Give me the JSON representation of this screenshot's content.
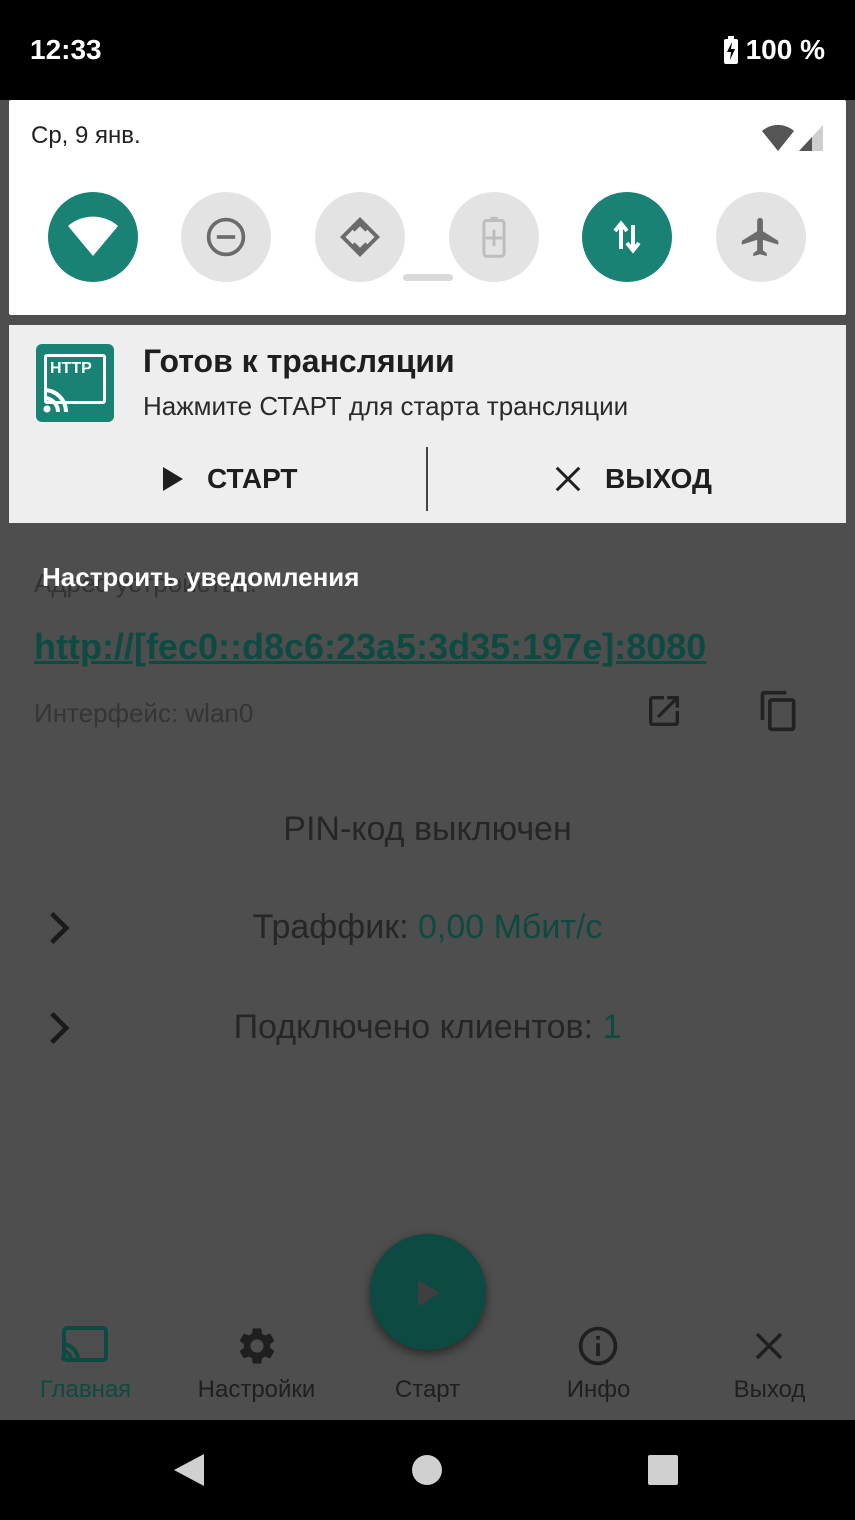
{
  "status_bar": {
    "time": "12:33",
    "battery": "100 %"
  },
  "quick_settings": {
    "date": "Ср, 9 янв.",
    "tiles": [
      {
        "name": "wifi",
        "state": "on"
      },
      {
        "name": "do-not-disturb",
        "state": "off"
      },
      {
        "name": "auto-rotate",
        "state": "off"
      },
      {
        "name": "battery-saver",
        "state": "off"
      },
      {
        "name": "mobile-data",
        "state": "on"
      },
      {
        "name": "airplane-mode",
        "state": "off"
      }
    ]
  },
  "notification": {
    "app_icon_text": "HTTP",
    "title": "Готов к трансляции",
    "text": "Нажмите СТАРТ для старта трансляции",
    "actions": {
      "start": "СТАРТ",
      "exit": "ВЫХОД"
    },
    "settings_link": "Настроить уведомления"
  },
  "app": {
    "device_address_label": "Адрес устройства:",
    "url": "http://[fec0::d8c6:23a5:3d35:197e]:8080",
    "interface": "Интерфейс: wlan0",
    "pin": "PIN-код выключен",
    "traffic_label": "Траффик: ",
    "traffic_value": "0,00 Мбит/с",
    "clients_label": "Подключено клиентов: ",
    "clients_value": "1"
  },
  "bottom_nav": {
    "items": [
      {
        "label": "Главная",
        "icon": "cast-icon",
        "active": true
      },
      {
        "label": "Настройки",
        "icon": "gear-icon",
        "active": false
      },
      {
        "label": "Старт",
        "icon": "play-icon",
        "active": false
      },
      {
        "label": "Инфо",
        "icon": "info-icon",
        "active": false
      },
      {
        "label": "Выход",
        "icon": "close-icon",
        "active": false
      }
    ]
  },
  "colors": {
    "accent": "#1a8275",
    "dim_accent": "#0d4a41"
  }
}
